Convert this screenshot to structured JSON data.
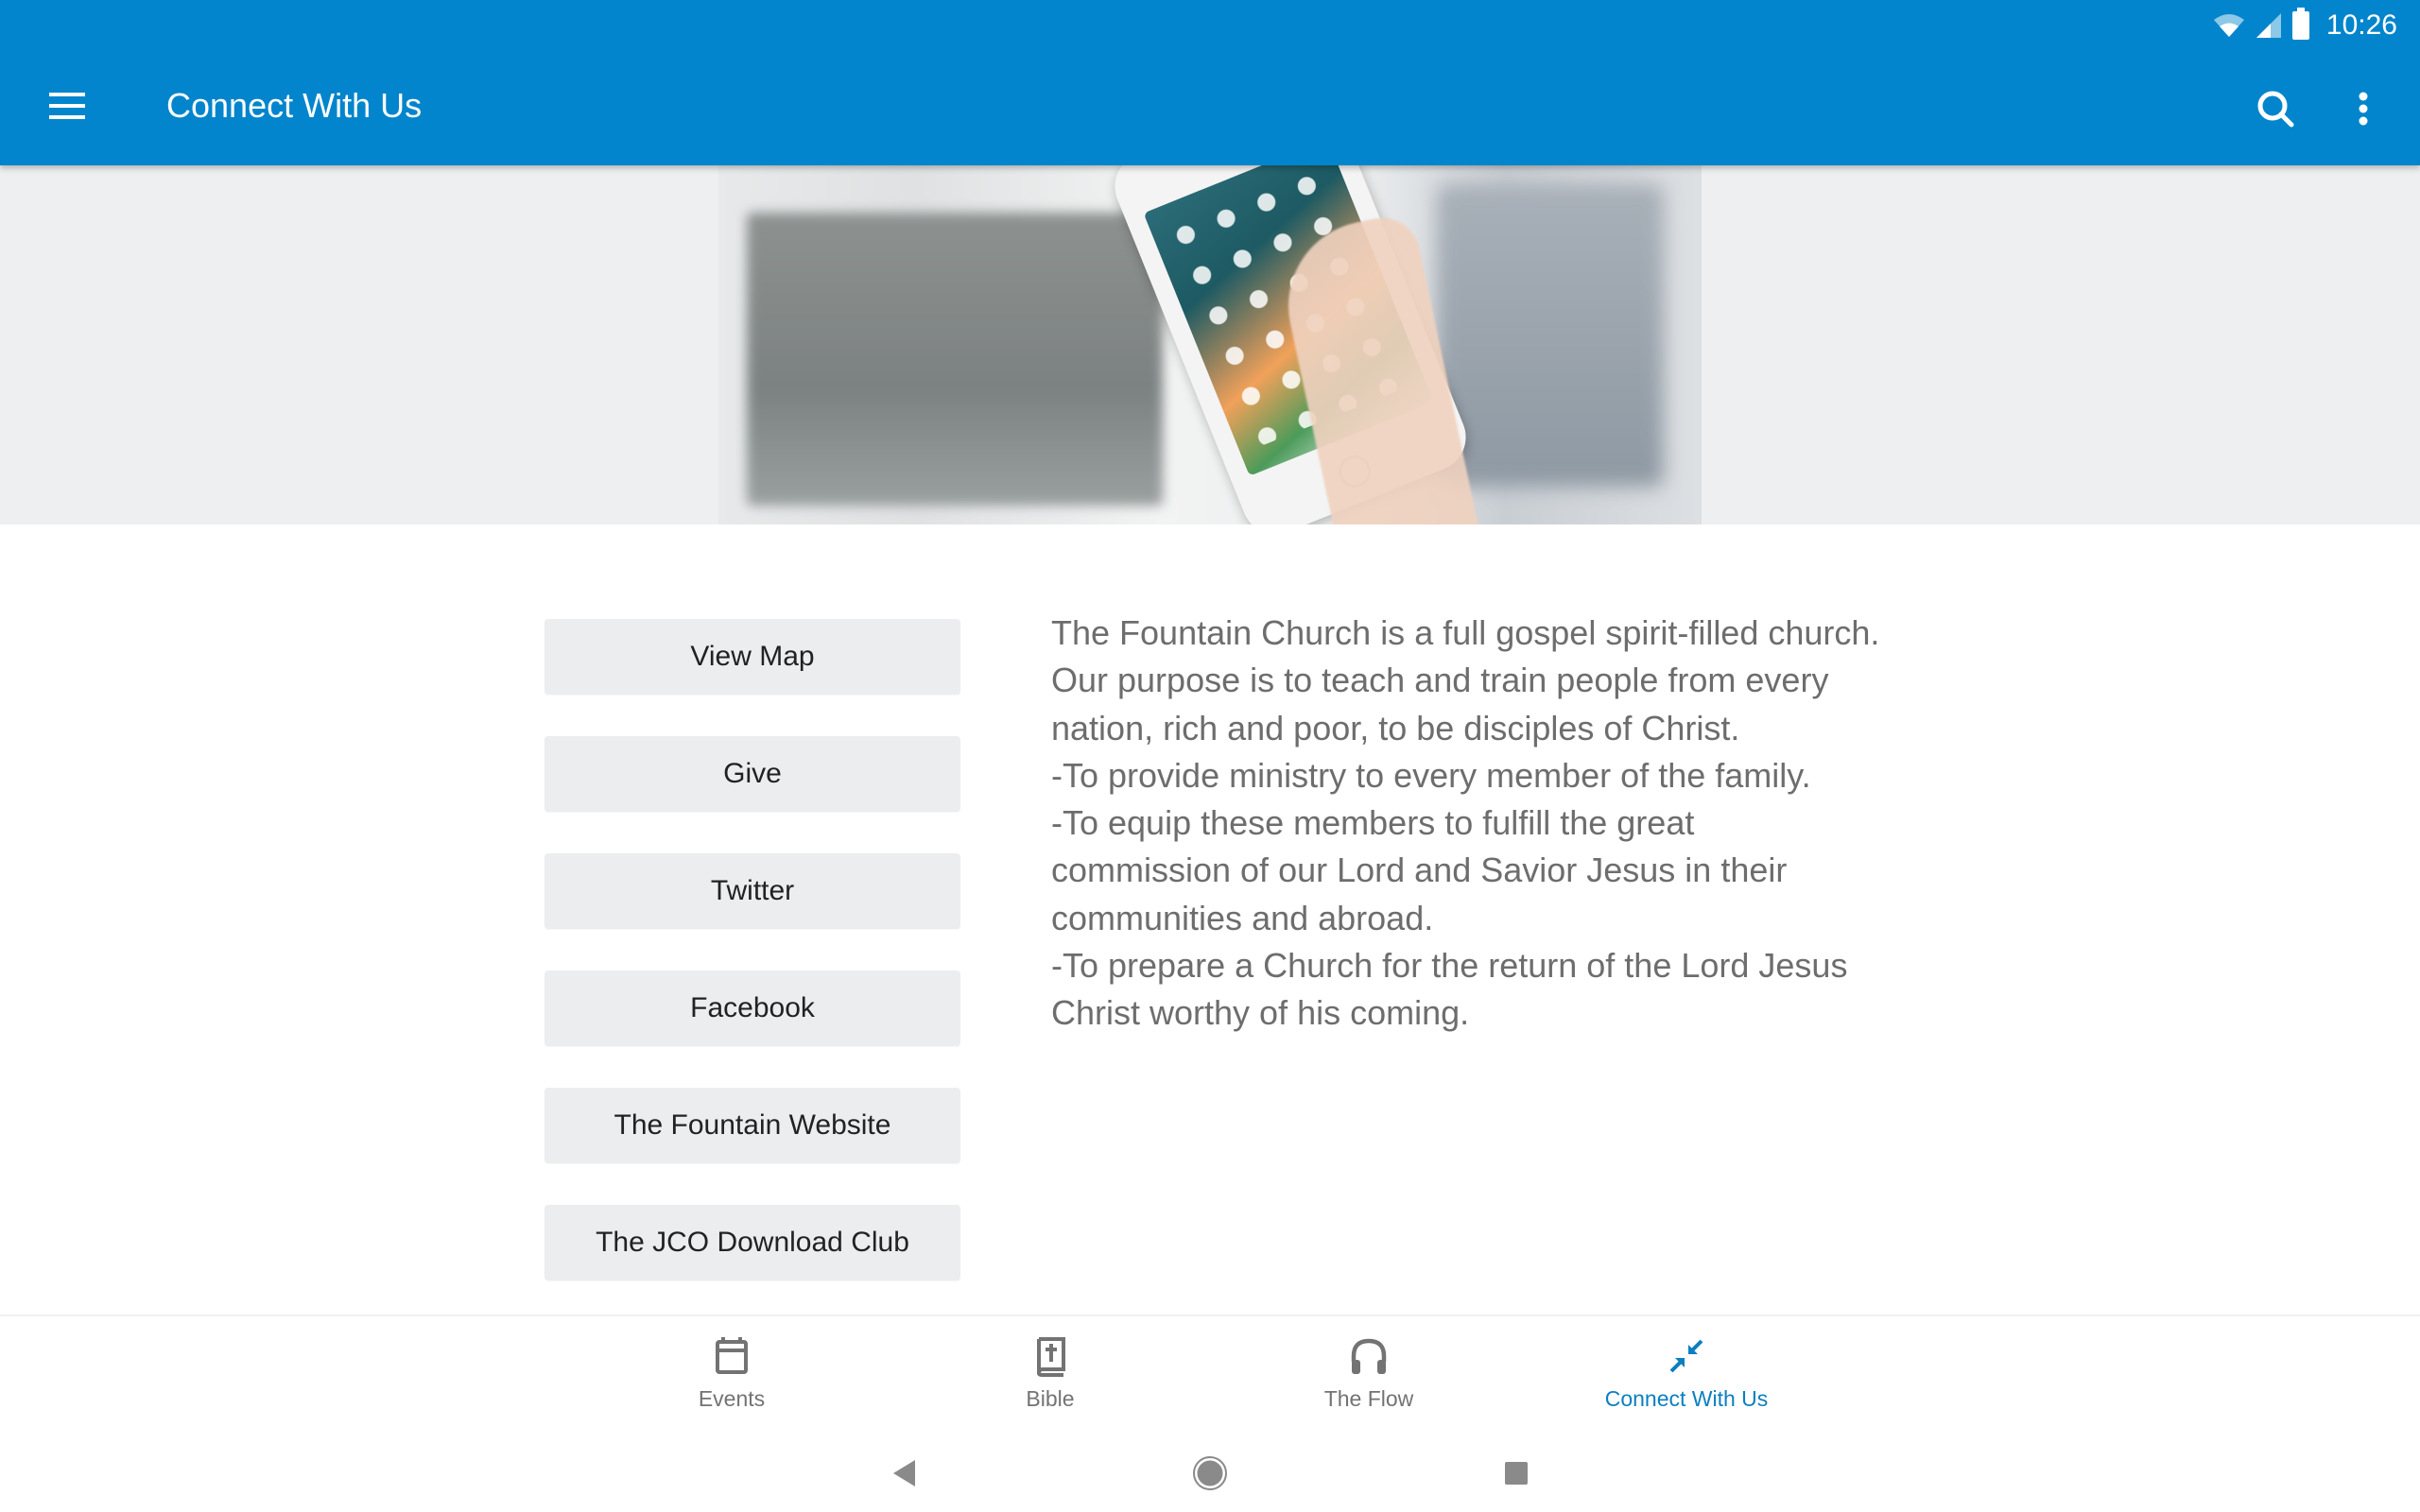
{
  "status_bar": {
    "time": "10:26",
    "icons": [
      "wifi-icon",
      "cell-signal-icon",
      "battery-icon"
    ]
  },
  "app_bar": {
    "title": "Connect With Us",
    "menu_icon": "hamburger-menu-icon",
    "search_icon": "search-icon",
    "more_icon": "more-vertical-icon"
  },
  "hero": {
    "description": "Hand holding a smartphone in front of blurred computer monitors"
  },
  "links": [
    {
      "label": "View Map"
    },
    {
      "label": "Give"
    },
    {
      "label": "Twitter"
    },
    {
      "label": "Facebook"
    },
    {
      "label": "The Fountain Website"
    },
    {
      "label": "The JCO Download Club"
    }
  ],
  "about": {
    "paragraphs": [
      "The Fountain Church is a full gospel spirit-filled church.",
      "Our purpose is to teach and train people from every nation, rich and poor, to be disciples of Christ.",
      "-To provide ministry to every member of the family.",
      "-To equip these members to fulfill the great commission of our Lord and Savior Jesus in their communities and abroad.",
      "-To prepare a Church for the return of the Lord Jesus Christ worthy of his coming."
    ]
  },
  "bottom_nav": {
    "items": [
      {
        "label": "Events",
        "icon": "calendar-icon",
        "active": false
      },
      {
        "label": "Bible",
        "icon": "bible-icon",
        "active": false
      },
      {
        "label": "The Flow",
        "icon": "headphones-icon",
        "active": false
      },
      {
        "label": "Connect With Us",
        "icon": "connect-arrows-icon",
        "active": true
      }
    ]
  },
  "system_nav": {
    "back": "back-icon",
    "home": "home-icon",
    "recents": "recents-icon"
  },
  "colors": {
    "primary": "#0285cc",
    "active_tab": "#0b7fc0",
    "button_bg": "#ebedef",
    "body_text": "#6d6d6d",
    "inactive_icon": "#737373"
  }
}
